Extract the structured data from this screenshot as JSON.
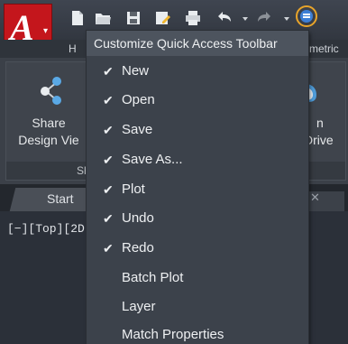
{
  "app": {
    "logo_letter": "A"
  },
  "ribbon": {
    "tab_left_partial": "H",
    "tab_right_partial": "metric",
    "share_label_line1": "Share",
    "share_label_line2": "Design Vie",
    "share_panel_footer": "Sh",
    "right_label_line1": "n",
    "right_label_line2": "Drive"
  },
  "filetabs": {
    "start": "Start"
  },
  "viewport": {
    "label": "[−][Top][2D"
  },
  "qat_menu": {
    "title": "Customize Quick Access Toolbar",
    "items": [
      {
        "label": "New",
        "checked": "✔"
      },
      {
        "label": "Open",
        "checked": "✔"
      },
      {
        "label": "Save",
        "checked": "✔"
      },
      {
        "label": "Save As...",
        "checked": "✔"
      },
      {
        "label": "Plot",
        "checked": "✔"
      },
      {
        "label": "Undo",
        "checked": "✔"
      },
      {
        "label": "Redo",
        "checked": "✔"
      },
      {
        "label": "Batch Plot",
        "checked": ""
      },
      {
        "label": "Layer",
        "checked": ""
      },
      {
        "label": "Match Properties",
        "checked": ""
      }
    ]
  },
  "colors": {
    "app_red": "#c4161c",
    "highlight_ring": "#e8a42a",
    "menu_bg": "#3c424b"
  }
}
